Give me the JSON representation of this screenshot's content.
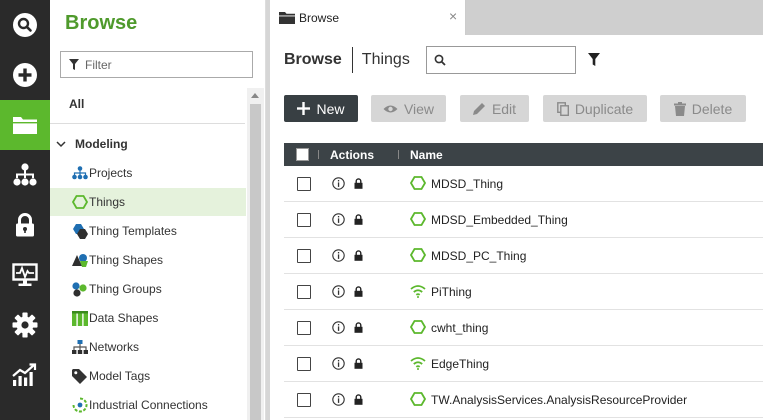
{
  "rail": {
    "items": [
      {
        "icon": "search-icon"
      },
      {
        "icon": "plus-circle-icon"
      },
      {
        "icon": "folder-icon",
        "active": true
      },
      {
        "icon": "hierarchy-icon"
      },
      {
        "icon": "lock-icon"
      },
      {
        "icon": "monitor-pulse-icon"
      },
      {
        "icon": "gear-icon"
      },
      {
        "icon": "analytics-chart-icon"
      }
    ]
  },
  "browse_panel": {
    "title": "Browse",
    "filter_placeholder": "Filter",
    "all_label": "All",
    "section_label": "Modeling",
    "items": [
      {
        "label": "Projects",
        "icon": "projects-icon"
      },
      {
        "label": "Things",
        "icon": "thing-hexagon-icon",
        "selected": true
      },
      {
        "label": "Thing Templates",
        "icon": "thing-templates-icon"
      },
      {
        "label": "Thing Shapes",
        "icon": "thing-shapes-icon"
      },
      {
        "label": "Thing Groups",
        "icon": "thing-groups-icon"
      },
      {
        "label": "Data Shapes",
        "icon": "data-shapes-icon"
      },
      {
        "label": "Networks",
        "icon": "networks-icon"
      },
      {
        "label": "Model Tags",
        "icon": "tag-icon"
      },
      {
        "label": "Industrial Connections",
        "icon": "industrial-connections-icon"
      }
    ]
  },
  "tab": {
    "label": "Browse",
    "close": "×"
  },
  "header": {
    "crumb_root": "Browse",
    "crumb_current": "Things",
    "search_value": ""
  },
  "toolbar": {
    "new_label": "New",
    "view_label": "View",
    "edit_label": "Edit",
    "duplicate_label": "Duplicate",
    "delete_label": "Delete"
  },
  "grid": {
    "columns": {
      "actions": "Actions",
      "name": "Name"
    },
    "rows": [
      {
        "name": "MDSD_Thing",
        "icon": "thing-hexagon-icon"
      },
      {
        "name": "MDSD_Embedded_Thing",
        "icon": "thing-hexagon-icon"
      },
      {
        "name": "MDSD_PC_Thing",
        "icon": "thing-hexagon-icon"
      },
      {
        "name": "PiThing",
        "icon": "wifi-thing-icon"
      },
      {
        "name": "cwht_thing",
        "icon": "thing-hexagon-icon"
      },
      {
        "name": "EdgeThing",
        "icon": "wifi-thing-icon"
      },
      {
        "name": "TW.AnalysisServices.AnalysisResourceProvider",
        "icon": "thing-hexagon-icon"
      }
    ]
  },
  "colors": {
    "accent": "#5cb82d",
    "rail_bg": "#2a2a2a",
    "header_bg": "#3c4347",
    "title_green": "#4f9a2c"
  }
}
